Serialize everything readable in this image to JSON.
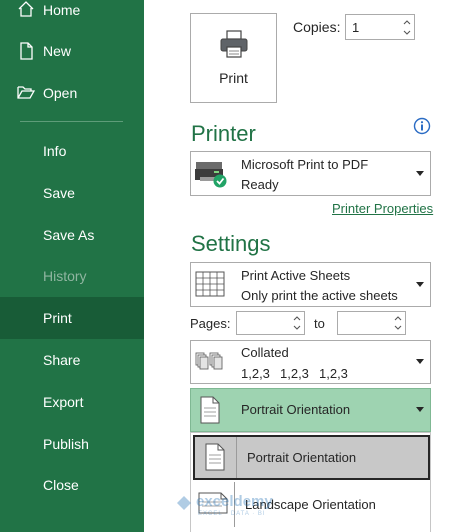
{
  "sidebar": {
    "items": [
      {
        "label": "Home",
        "icon": "home-icon"
      },
      {
        "label": "New",
        "icon": "new-file-icon"
      },
      {
        "label": "Open",
        "icon": "open-folder-icon"
      },
      {
        "label": "Info"
      },
      {
        "label": "Save"
      },
      {
        "label": "Save As"
      },
      {
        "label": "History",
        "disabled": true
      },
      {
        "label": "Print",
        "selected": true
      },
      {
        "label": "Share"
      },
      {
        "label": "Export"
      },
      {
        "label": "Publish"
      },
      {
        "label": "Close"
      }
    ],
    "bg_color": "#217346",
    "selected_color": "#185c37"
  },
  "print": {
    "button_label": "Print",
    "copies_label": "Copies:",
    "copies_value": "1"
  },
  "printer": {
    "section_title": "Printer",
    "name": "Microsoft Print to PDF",
    "status": "Ready",
    "properties_link": "Printer Properties",
    "info_icon": "info-icon"
  },
  "settings": {
    "section_title": "Settings",
    "sheets": {
      "title": "Print Active Sheets",
      "subtitle": "Only print the active sheets"
    },
    "pages_label": "Pages:",
    "pages_from": "",
    "pages_to_label": "to",
    "pages_to": "",
    "collated": {
      "title": "Collated",
      "sequence": [
        "1,2,3",
        "1,2,3",
        "1,2,3"
      ]
    },
    "orientation": {
      "selected": "Portrait Orientation",
      "options": [
        "Portrait Orientation",
        "Landscape Orientation"
      ]
    }
  },
  "watermark": {
    "brand": "exceldemy",
    "tagline": "EXCEL · DATA · BI"
  },
  "colors": {
    "accent": "#217346",
    "selected_option": "#c8c8c8",
    "orientation_bg": "#9ed3b1"
  }
}
